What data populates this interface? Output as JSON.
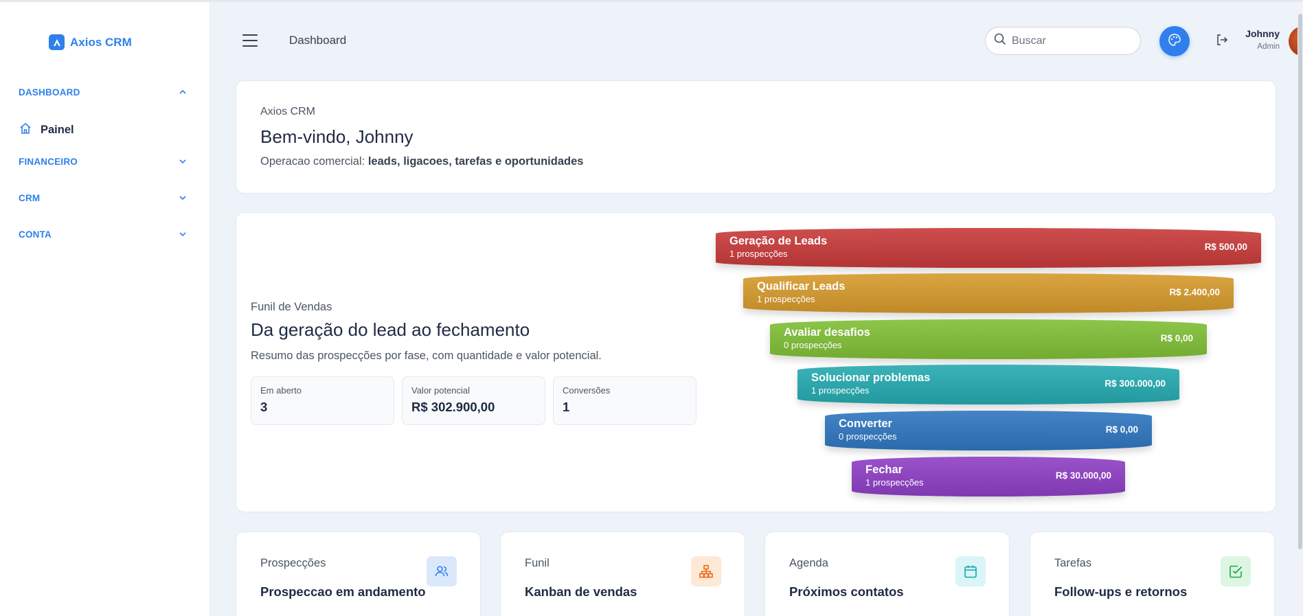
{
  "brand": {
    "name": "Axios CRM"
  },
  "sidebar": {
    "sections": [
      {
        "label": "DASHBOARD",
        "expanded": true,
        "items": [
          {
            "label": "Painel",
            "icon": "home-icon"
          }
        ]
      },
      {
        "label": "FINANCEIRO",
        "expanded": false
      },
      {
        "label": "CRM",
        "expanded": false
      },
      {
        "label": "CONTA",
        "expanded": false
      }
    ]
  },
  "header": {
    "title": "Dashboard",
    "search_placeholder": "Buscar",
    "user": {
      "name": "Johnny",
      "role": "Admin"
    }
  },
  "welcome": {
    "app": "Axios CRM",
    "title": "Bem-vindo, Johnny",
    "subtitle_prefix": "Operacao comercial: ",
    "subtitle_bold": "leads, ligacoes, tarefas e oportunidades"
  },
  "funnel": {
    "kicker": "Funil de Vendas",
    "title": "Da geração do lead ao fechamento",
    "description": "Resumo das prospecções por fase, com quantidade e valor potencial.",
    "stats": [
      {
        "label": "Em aberto",
        "value": "3"
      },
      {
        "label": "Valor potencial",
        "value": "R$ 302.900,00"
      },
      {
        "label": "Conversões",
        "value": "1"
      }
    ],
    "stages": [
      {
        "name": "Geração de Leads",
        "count": "1 prospecções",
        "value": "R$ 500,00",
        "color": "#c83a3a"
      },
      {
        "name": "Qualificar Leads",
        "count": "1 prospecções",
        "value": "R$ 2.400,00",
        "color": "#d69a2c"
      },
      {
        "name": "Avaliar desafios",
        "count": "0 prospecções",
        "value": "R$ 0,00",
        "color": "#7fbf35"
      },
      {
        "name": "Solucionar problemas",
        "count": "1 prospecções",
        "value": "R$ 300.000,00",
        "color": "#25aab0"
      },
      {
        "name": "Converter",
        "count": "0 prospecções",
        "value": "R$ 0,00",
        "color": "#2f76c0"
      },
      {
        "name": "Fechar",
        "count": "1 prospecções",
        "value": "R$ 30.000,00",
        "color": "#8e3fc4"
      }
    ]
  },
  "shortcuts": [
    {
      "kicker": "Prospecções",
      "title": "Prospeccao em andamento",
      "icon": "users-icon",
      "icon_bg": "#dbe8fb",
      "icon_color": "#2f80ed"
    },
    {
      "kicker": "Funil",
      "title": "Kanban de vendas",
      "icon": "org-chart-icon",
      "icon_bg": "#fde9d6",
      "icon_color": "#e86a1a"
    },
    {
      "kicker": "Agenda",
      "title": "Próximos contatos",
      "icon": "calendar-icon",
      "icon_bg": "#d9f5f7",
      "icon_color": "#14a3b0"
    },
    {
      "kicker": "Tarefas",
      "title": "Follow-ups e retornos",
      "icon": "check-square-icon",
      "icon_bg": "#dcf6e3",
      "icon_color": "#1fa54a"
    }
  ]
}
